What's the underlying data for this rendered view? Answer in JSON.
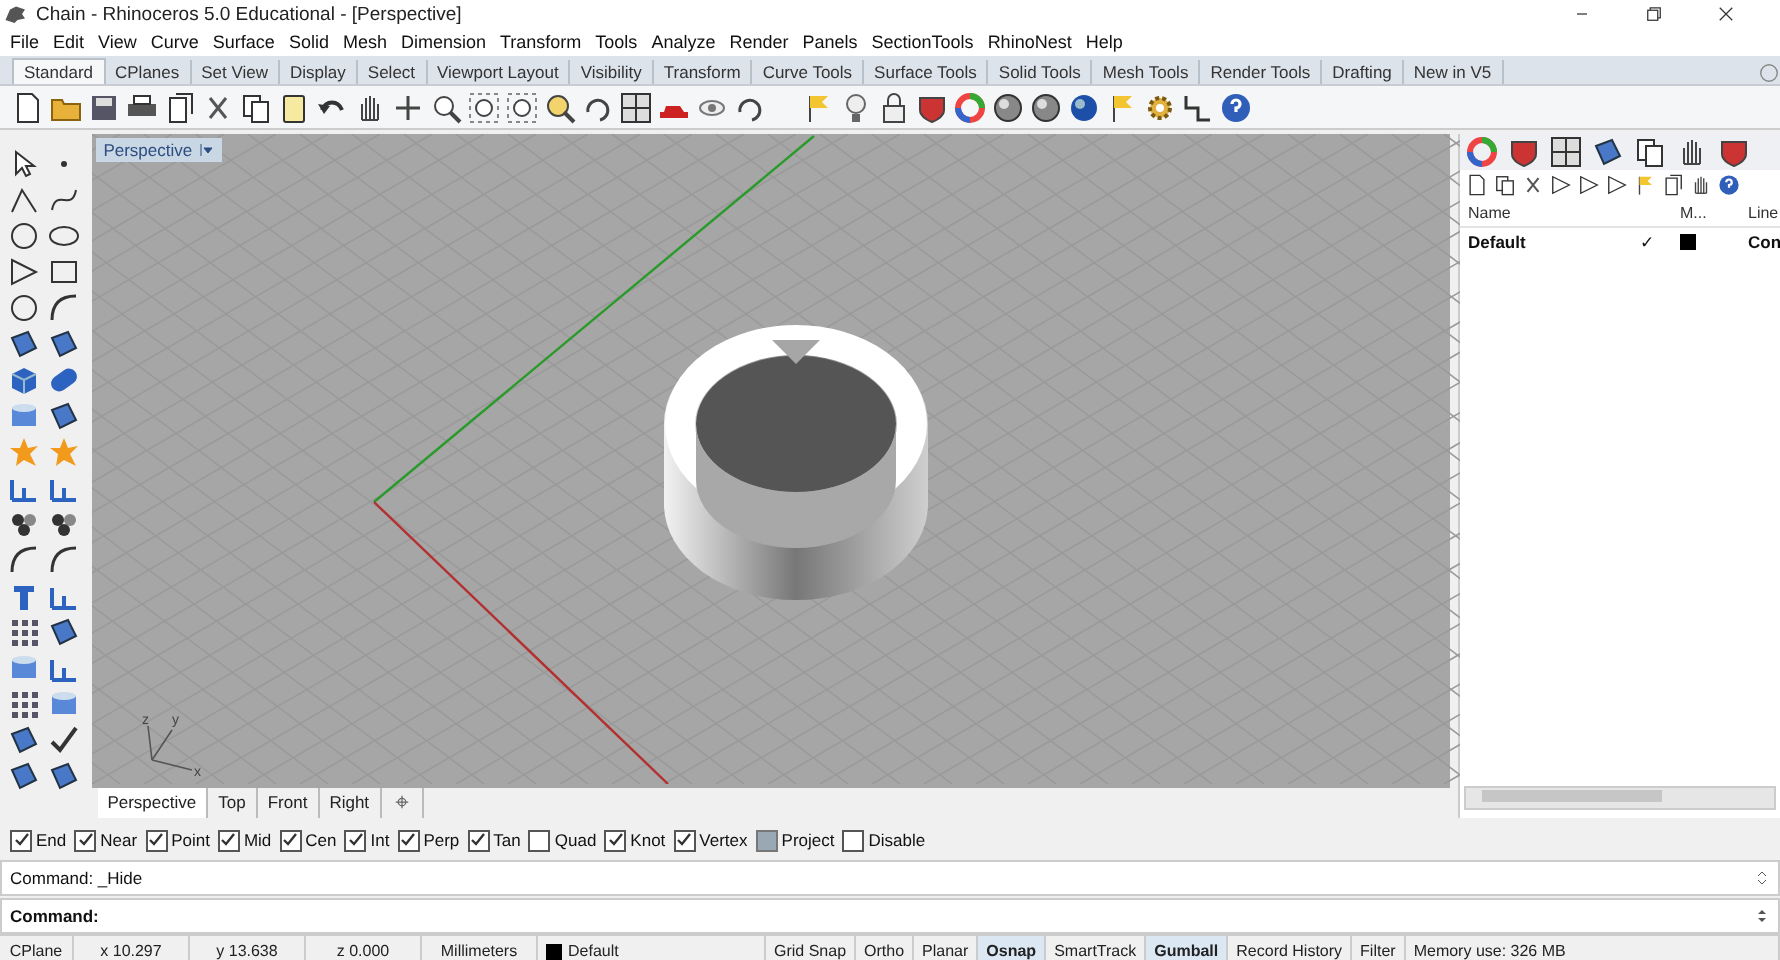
{
  "window": {
    "title": "Chain - Rhinoceros 5.0 Educational - [Perspective]"
  },
  "menu": [
    "File",
    "Edit",
    "View",
    "Curve",
    "Surface",
    "Solid",
    "Mesh",
    "Dimension",
    "Transform",
    "Tools",
    "Analyze",
    "Render",
    "Panels",
    "SectionTools",
    "RhinoNest",
    "Help"
  ],
  "toolbar_tabs": [
    {
      "label": "Standard",
      "selected": true
    },
    {
      "label": "CPlanes",
      "selected": false
    },
    {
      "label": "Set View",
      "selected": false
    },
    {
      "label": "Display",
      "selected": false
    },
    {
      "label": "Select",
      "selected": false
    },
    {
      "label": "Viewport Layout",
      "selected": false
    },
    {
      "label": "Visibility",
      "selected": false
    },
    {
      "label": "Transform",
      "selected": false
    },
    {
      "label": "Curve Tools",
      "selected": false
    },
    {
      "label": "Surface Tools",
      "selected": false
    },
    {
      "label": "Solid Tools",
      "selected": false
    },
    {
      "label": "Mesh Tools",
      "selected": false
    },
    {
      "label": "Render Tools",
      "selected": false
    },
    {
      "label": "Drafting",
      "selected": false
    },
    {
      "label": "New in V5",
      "selected": false
    }
  ],
  "viewport": {
    "label": "Perspective",
    "axis_labels": [
      "z",
      "y",
      "x"
    ],
    "tabs": [
      {
        "label": "Perspective",
        "selected": true
      },
      {
        "label": "Top",
        "selected": false
      },
      {
        "label": "Front",
        "selected": false
      },
      {
        "label": "Right",
        "selected": false
      }
    ]
  },
  "layers_panel": {
    "columns": [
      "Name",
      "M...",
      "Line"
    ],
    "rows": [
      {
        "name": "Default",
        "current": true,
        "check": "✓",
        "color": "#000000",
        "linetype": "Con"
      }
    ]
  },
  "osnaps": [
    {
      "kind": "check",
      "label": "End",
      "checked": true
    },
    {
      "kind": "check",
      "label": "Near",
      "checked": true
    },
    {
      "kind": "check",
      "label": "Point",
      "checked": true
    },
    {
      "kind": "check",
      "label": "Mid",
      "checked": true
    },
    {
      "kind": "check",
      "label": "Cen",
      "checked": true
    },
    {
      "kind": "check",
      "label": "Int",
      "checked": true
    },
    {
      "kind": "check",
      "label": "Perp",
      "checked": true
    },
    {
      "kind": "check",
      "label": "Tan",
      "checked": true
    },
    {
      "kind": "check",
      "label": "Quad",
      "checked": false
    },
    {
      "kind": "check",
      "label": "Knot",
      "checked": true
    },
    {
      "kind": "check",
      "label": "Vertex",
      "checked": true
    },
    {
      "kind": "toggle",
      "label": "Project",
      "on": true
    },
    {
      "kind": "toggle",
      "label": "Disable",
      "on": false
    }
  ],
  "command": {
    "history": "Command: _Hide",
    "prompt": "Command:"
  },
  "status_bar": [
    {
      "kind": "text",
      "text": "CPlane"
    },
    {
      "kind": "text",
      "text": "x 10.297"
    },
    {
      "kind": "text",
      "text": "y 13.638"
    },
    {
      "kind": "text",
      "text": "z 0.000"
    },
    {
      "kind": "text",
      "text": "Millimeters"
    },
    {
      "kind": "layer",
      "text": "Default",
      "color": "#000000"
    },
    {
      "kind": "toggle",
      "text": "Grid Snap",
      "on": false
    },
    {
      "kind": "toggle",
      "text": "Ortho",
      "on": false
    },
    {
      "kind": "toggle",
      "text": "Planar",
      "on": false
    },
    {
      "kind": "toggle",
      "text": "Osnap",
      "on": true
    },
    {
      "kind": "toggle",
      "text": "SmartTrack",
      "on": false
    },
    {
      "kind": "toggle",
      "text": "Gumball",
      "on": true
    },
    {
      "kind": "toggle",
      "text": "Record History",
      "on": false
    },
    {
      "kind": "toggle",
      "text": "Filter",
      "on": false
    },
    {
      "kind": "memory",
      "text": "Memory use: 326 MB"
    }
  ]
}
